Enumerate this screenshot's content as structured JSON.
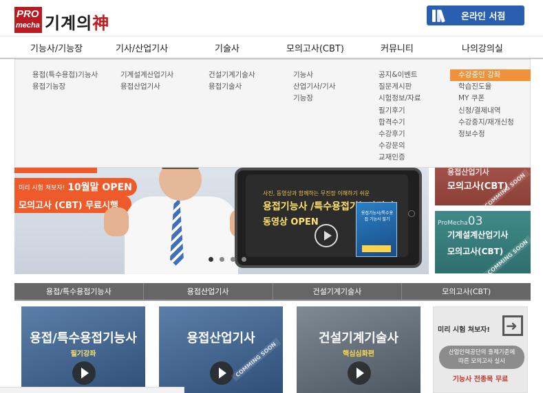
{
  "header": {
    "logo": {
      "pro": "PRO",
      "mecha": "mecha",
      "brand_main": "기계의",
      "brand_god": "神"
    },
    "online_store_label": "온라인 서점"
  },
  "nav": {
    "items": [
      "기능사/기능장",
      "기사/산업기사",
      "기술사",
      "모의고사(CBT)",
      "커뮤니티",
      "나의강의실"
    ]
  },
  "dropdown": {
    "columns": [
      [
        "용접(특수용접)기능사",
        "용접기능장"
      ],
      [
        "기계설계산업기사",
        "용접산업기사"
      ],
      [
        "건설기계기술사",
        "용접기술사"
      ],
      [
        "기능사",
        "산업기사/기사",
        "기능장"
      ],
      [
        "공지&이벤트",
        "질문게시판",
        "시험정보/자료",
        "필기후기",
        "합격수기",
        "수강후기",
        "수강문의",
        "교재인증"
      ],
      [
        "수강중인 강좌",
        "학습진도율",
        "MY 쿠폰",
        "신청/결제내역",
        "수강중지/재개신청",
        "정보수정"
      ]
    ],
    "active": "수강중인 강좌"
  },
  "banner": {
    "pill_small": "미리 시험 쳐보자!",
    "pill_big": "10월말 OPEN",
    "pill2": "모의고사 (CBT) 무료시행",
    "phone_caption": "사진, 동영상과 함께하는 무진장 이해하기 쉬운",
    "phone_title1": "용접기능사 /특수용접기능사필기",
    "phone_title2": "동영상 OPEN",
    "book_title": "용접기능사/특수용접 기능사 필기",
    "slides": 4,
    "active_slide": 0
  },
  "right_promos": {
    "promo1_t1": "용접산업기사",
    "promo1_t2": "모의고사(CBT)",
    "promo1_soon": "COMMING SOON",
    "promo2_label": "ProMecha",
    "promo2_num": "03",
    "promo2_t1": "기계설계산업기사",
    "promo2_t2": "모의고사(CBT)",
    "promo2_soon": "COMMING SOON"
  },
  "categories": [
    "용접/특수용접기능사",
    "용접산업기사",
    "건설기계기술사",
    "모의고사(CBT)"
  ],
  "cards": [
    {
      "title": "용접/특수용접기능사",
      "sub": "필기강좌",
      "soon": ""
    },
    {
      "title": "용접산업기사",
      "sub": "",
      "soon": "COMMING SOON"
    },
    {
      "title": "건설기계기술사",
      "sub": "핵심심화편",
      "soon": ""
    }
  ],
  "promo_card": {
    "head": "미리 시험 쳐보자!",
    "bubble_line1": "산업인력공단의 출제기준에",
    "bubble_line2": "따른 모의고사 실시",
    "bottom": "기능사 전종목 무료"
  },
  "colors": {
    "accent_orange": "#f0923b",
    "store_blue": "#2a5fb0",
    "banner_red": "#ef5a2b",
    "logo_red": "#b81c22"
  }
}
